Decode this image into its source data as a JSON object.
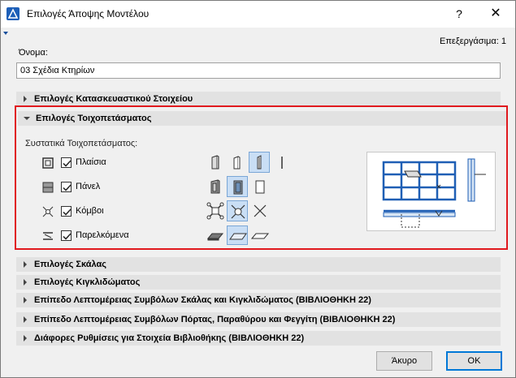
{
  "window": {
    "title": "Επιλογές Άποψης Μοντέλου",
    "help_label": "?",
    "close_label": "✕"
  },
  "edit_info": "Επεξεργάσιμα: 1",
  "name_field": {
    "label": "Όνομα:",
    "value": "03 Σχέδια Κτηρίων"
  },
  "sections": {
    "construction": "Επιλογές Κατασκευαστικού Στοιχείου",
    "curtain_wall": "Επιλογές Τοιχοπετάσματος",
    "stair": "Επιλογές Σκάλας",
    "railing": "Επιλογές Κιγκλιδώματος",
    "stair_railing_detail": "Επίπεδο Λεπτομέρειας Συμβόλων Σκάλας και Κιγκλιδώματος (ΒΙΒΛΙΟΘΗΚΗ 22)",
    "door_window_detail": "Επίπεδο Λεπτομέρειας Συμβόλων Πόρτας, Παραθύρου και Φεγγίτη (ΒΙΒΛΙΟΘΗΚΗ 22)",
    "library_misc": "Διάφορες Ρυθμίσεις για Στοιχεία Βιβλιοθήκης (ΒΙΒΛΙΟΘΗΚΗ 22)"
  },
  "curtain_wall": {
    "components_label": "Συστατικά Τοιχοπετάσματος:",
    "rows": [
      {
        "label": "Πλαίσια",
        "checked": true,
        "icon": "frame-icon",
        "selected_option": 3
      },
      {
        "label": "Πάνελ",
        "checked": true,
        "icon": "panel-icon",
        "selected_option": 2
      },
      {
        "label": "Κόμβοι",
        "checked": true,
        "icon": "junction-icon",
        "selected_option": 2
      },
      {
        "label": "Παρελκόμενα",
        "checked": true,
        "icon": "accessory-icon",
        "selected_option": 2
      }
    ]
  },
  "buttons": {
    "cancel": "Άκυρο",
    "ok": "OK"
  },
  "colors": {
    "highlight_border": "#e0191e",
    "selected_option_bg": "#c9def5",
    "preview_blue": "#1f5fb5"
  }
}
